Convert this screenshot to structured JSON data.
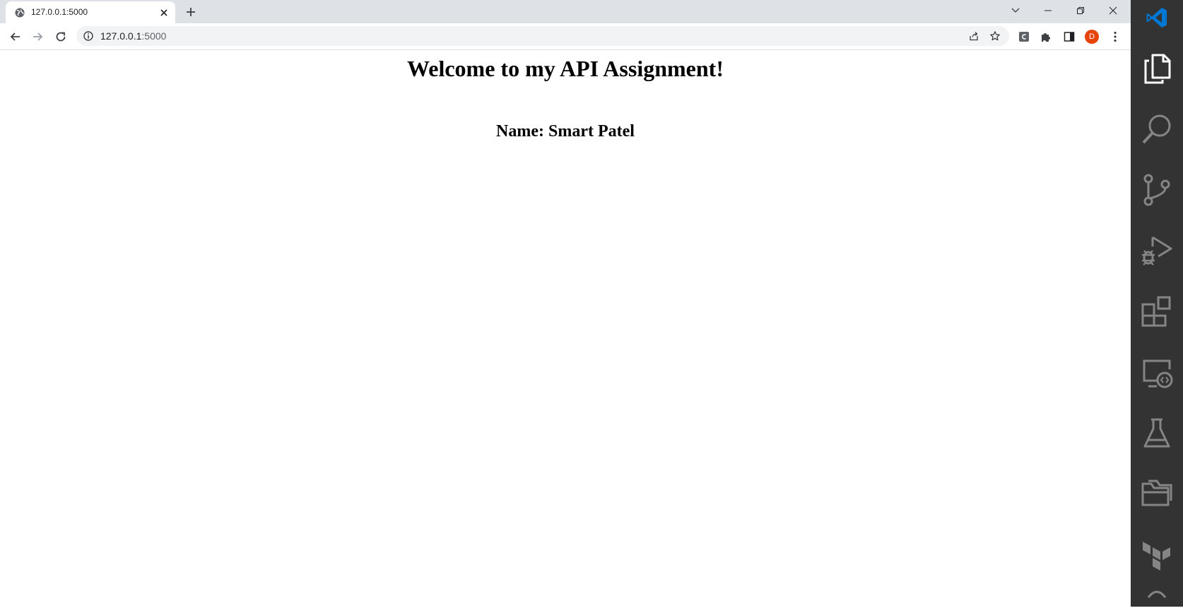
{
  "browser": {
    "tab_title": "127.0.0.1:5000",
    "url_host": "127.0.0.1",
    "url_port": ":5000",
    "profile_initial": "D",
    "profile_color": "#e8440a"
  },
  "page": {
    "heading": "Welcome to my API Assignment!",
    "subheading": "Name: Smart Patel"
  },
  "vscode": {
    "activity_items": [
      "explorer-icon",
      "search-icon",
      "source-control-icon",
      "run-debug-icon",
      "extensions-icon",
      "remote-explorer-icon",
      "testing-icon",
      "folder-icon",
      "terraform-icon"
    ],
    "accent": "#0078d4"
  }
}
